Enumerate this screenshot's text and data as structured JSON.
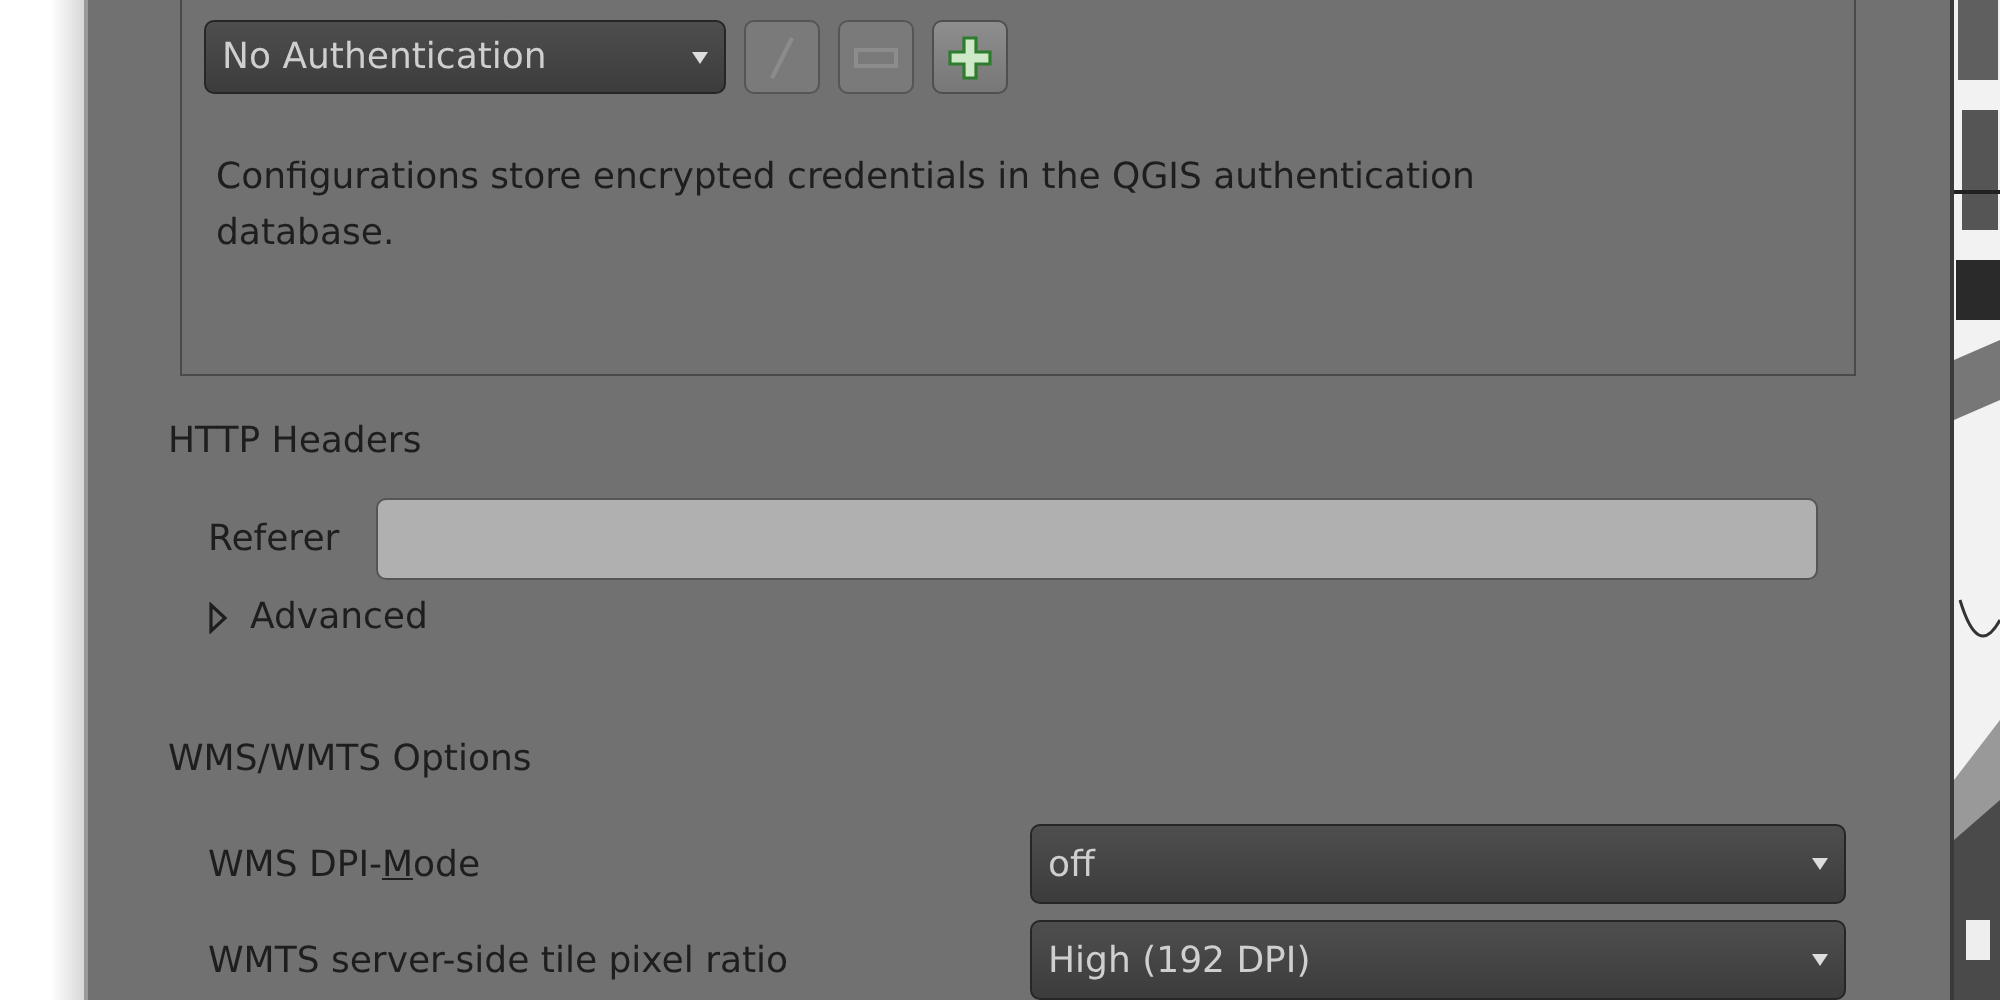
{
  "authentication": {
    "config": {
      "value": "No Authentication"
    },
    "buttons": [
      {
        "kind": "edit",
        "disabled": true
      },
      {
        "kind": "remove",
        "disabled": true
      },
      {
        "kind": "add",
        "disabled": false
      }
    ],
    "note": "Configurations store encrypted credentials in the QGIS authentication database."
  },
  "http_headers": {
    "title": "HTTP Headers",
    "referer": {
      "label": "Referer"
    },
    "advanced": {
      "label": "Advanced",
      "expanded": false
    }
  },
  "wms_wmts_options": {
    "title": "WMS/WMTS Options",
    "rows": [
      {
        "label_before": "WMS DPI-",
        "mnemonic": "M",
        "label_after": "ode",
        "value": "off"
      },
      {
        "label_before": "WMTS server-side tile pixel ratio",
        "value": "High (192 DPI)"
      }
    ]
  }
}
